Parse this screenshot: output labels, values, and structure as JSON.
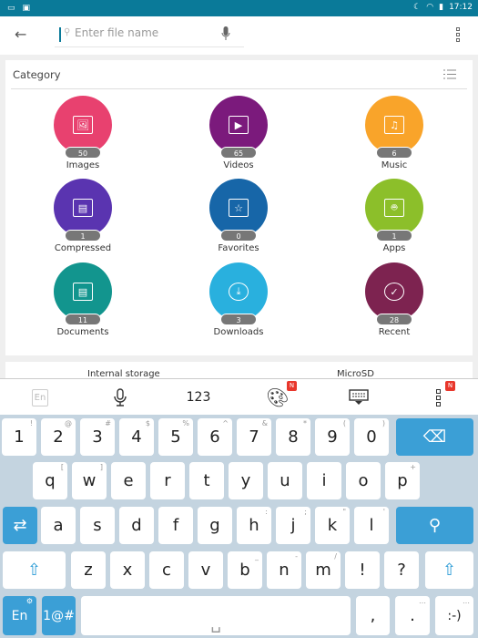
{
  "status_bar": {
    "time": "17:12",
    "icons": [
      "keyboard-icon",
      "image-icon",
      "moon-icon",
      "wifi-icon",
      "battery-icon"
    ]
  },
  "toolbar": {
    "search_placeholder": "Enter file name",
    "icons": [
      "back-arrow-icon",
      "search-icon",
      "mic-icon",
      "more-icon"
    ]
  },
  "category": {
    "title": "Category",
    "items": [
      {
        "label": "Images",
        "count": "50",
        "color": "#e8416f",
        "icon": "image-icon"
      },
      {
        "label": "Videos",
        "count": "65",
        "color": "#7b1a7c",
        "icon": "video-icon"
      },
      {
        "label": "Music",
        "count": "6",
        "color": "#f9a42a",
        "icon": "music-icon"
      },
      {
        "label": "Compressed",
        "count": "1",
        "color": "#5a34b0",
        "icon": "zip-icon"
      },
      {
        "label": "Favorites",
        "count": "0",
        "color": "#1766a8",
        "icon": "star-icon"
      },
      {
        "label": "Apps",
        "count": "1",
        "color": "#8cbf2a",
        "icon": "android-icon"
      },
      {
        "label": "Documents",
        "count": "11",
        "color": "#12958e",
        "icon": "document-icon"
      },
      {
        "label": "Downloads",
        "count": "3",
        "color": "#29b0de",
        "icon": "download-icon"
      },
      {
        "label": "Recent",
        "count": "28",
        "color": "#7d2350",
        "icon": "check-circle-icon"
      }
    ]
  },
  "storage": {
    "internal": "Internal storage",
    "microsd": "MicroSD"
  },
  "keyboard_toolbar": {
    "lang": "En",
    "numbers": "123",
    "new_badge": "N"
  },
  "keyboard": {
    "rows": [
      [
        {
          "k": "1",
          "h": "!"
        },
        {
          "k": "2",
          "h": "@"
        },
        {
          "k": "3",
          "h": "#"
        },
        {
          "k": "4",
          "h": "$"
        },
        {
          "k": "5",
          "h": "%"
        },
        {
          "k": "6",
          "h": "^"
        },
        {
          "k": "7",
          "h": "&"
        },
        {
          "k": "8",
          "h": "*"
        },
        {
          "k": "9",
          "h": "("
        },
        {
          "k": "0",
          "h": ")"
        },
        {
          "k": "⌫",
          "name": "backspace"
        }
      ],
      [
        {
          "k": "q",
          "h": "["
        },
        {
          "k": "w",
          "h": "]"
        },
        {
          "k": "e"
        },
        {
          "k": "r"
        },
        {
          "k": "t"
        },
        {
          "k": "y"
        },
        {
          "k": "u"
        },
        {
          "k": "i"
        },
        {
          "k": "o"
        },
        {
          "k": "p",
          "h": "+"
        }
      ],
      [
        {
          "k": "⇄",
          "name": "tab"
        },
        {
          "k": "a"
        },
        {
          "k": "s"
        },
        {
          "k": "d"
        },
        {
          "k": "f"
        },
        {
          "k": "g"
        },
        {
          "k": "h",
          "h": ":"
        },
        {
          "k": "j",
          "h": ";"
        },
        {
          "k": "k",
          "h": "\""
        },
        {
          "k": "l",
          "h": "'"
        },
        {
          "k": "⚲",
          "name": "search"
        }
      ],
      [
        {
          "k": "⇧",
          "name": "shift-left"
        },
        {
          "k": "z"
        },
        {
          "k": "x"
        },
        {
          "k": "c"
        },
        {
          "k": "v"
        },
        {
          "k": "b",
          "h": "_"
        },
        {
          "k": "n",
          "h": "-"
        },
        {
          "k": "m",
          "h": "/"
        },
        {
          "k": "!"
        },
        {
          "k": "?"
        },
        {
          "k": "⇧",
          "name": "shift-right"
        }
      ],
      [
        {
          "k": "En",
          "name": "language",
          "h": "⚙"
        },
        {
          "k": "1@#",
          "name": "symbols"
        },
        {
          "k": "␣",
          "name": "space"
        },
        {
          "k": ","
        },
        {
          "k": ".",
          "h": "…"
        },
        {
          "k": ":-)",
          "name": "emoticon",
          "h": "…"
        }
      ]
    ]
  }
}
